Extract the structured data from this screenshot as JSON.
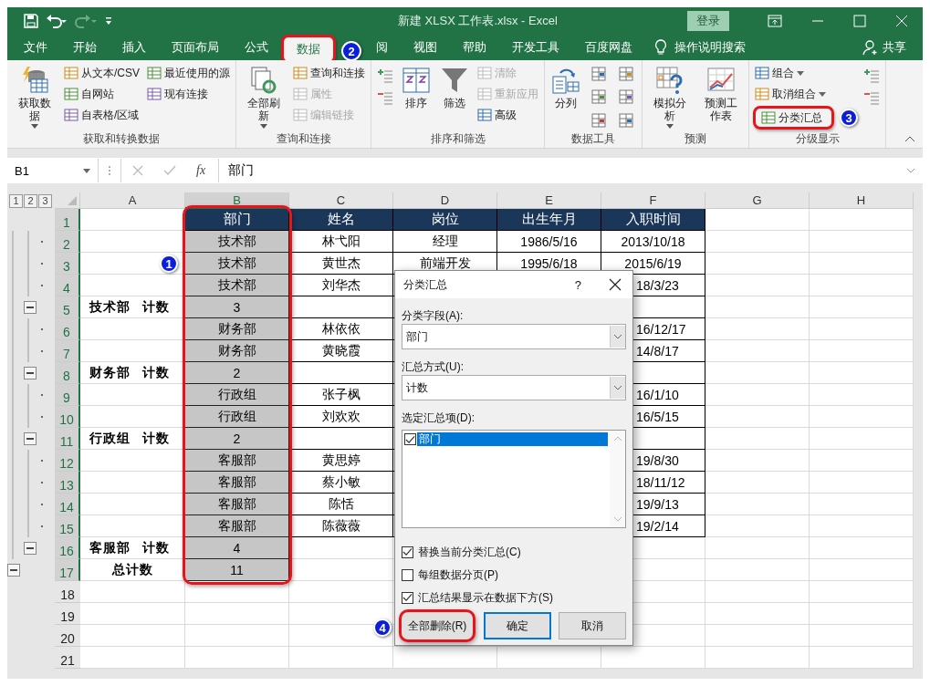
{
  "title_bar": {
    "title": "新建 XLSX 工作表.xlsx  -  Excel",
    "sign_in": "登录"
  },
  "tabs": [
    {
      "label": "文件",
      "selected": false,
      "highlighted": false
    },
    {
      "label": "开始",
      "selected": false,
      "highlighted": false
    },
    {
      "label": "插入",
      "selected": false,
      "highlighted": false
    },
    {
      "label": "页面布局",
      "selected": false,
      "highlighted": false
    },
    {
      "label": "公式",
      "selected": false,
      "highlighted": false
    },
    {
      "label": "数据",
      "selected": true,
      "highlighted": true,
      "marker": "2"
    },
    {
      "label": "阅",
      "selected": false,
      "highlighted": false
    },
    {
      "label": "视图",
      "selected": false,
      "highlighted": false
    },
    {
      "label": "帮助",
      "selected": false,
      "highlighted": false
    },
    {
      "label": "开发工具",
      "selected": false,
      "highlighted": false
    },
    {
      "label": "百度网盘",
      "selected": false,
      "highlighted": false
    }
  ],
  "tell_me": "操作说明搜索",
  "share": "共享",
  "ribbon": [
    {
      "label": "获取和转换数据",
      "items": [
        {
          "kind": "large",
          "label": "获取数据",
          "dropdown": true
        },
        {
          "kind": "column",
          "items": [
            {
              "label": "从文本/CSV",
              "disabled": false
            },
            {
              "label": "自网站",
              "disabled": false
            },
            {
              "label": "自表格/区域",
              "disabled": false
            }
          ]
        },
        {
          "kind": "column",
          "items": [
            {
              "label": "最近使用的源",
              "disabled": false
            },
            {
              "label": "现有连接",
              "disabled": false
            }
          ]
        }
      ]
    },
    {
      "label": "查询和连接",
      "items": [
        {
          "kind": "large",
          "label": "全部刷新",
          "dropdown": true
        },
        {
          "kind": "column",
          "items": [
            {
              "label": "查询和连接",
              "disabled": false
            },
            {
              "label": "属性",
              "disabled": true
            },
            {
              "label": "编辑链接",
              "disabled": true
            }
          ]
        }
      ]
    },
    {
      "label": "排序和筛选",
      "items": [
        {
          "kind": "icon_column"
        },
        {
          "kind": "large",
          "label": "排序",
          "dropdown": false
        },
        {
          "kind": "large",
          "label": "筛选",
          "dropdown": false
        },
        {
          "kind": "column",
          "items": [
            {
              "label": "清除",
              "disabled": true
            },
            {
              "label": "重新应用",
              "disabled": true
            },
            {
              "label": "高级",
              "disabled": false
            }
          ]
        }
      ]
    },
    {
      "label": "数据工具",
      "items": [
        {
          "kind": "large",
          "label": "分列",
          "dropdown": false
        },
        {
          "kind": "icon_grid"
        }
      ]
    },
    {
      "label": "预测",
      "items": [
        {
          "kind": "large",
          "label": "模拟分析",
          "dropdown": true
        },
        {
          "kind": "large",
          "label": "预测工作表",
          "dropdown": false
        }
      ]
    },
    {
      "label": "分级显示",
      "items": [
        {
          "kind": "column",
          "items": [
            {
              "label": "组合",
              "disabled": false,
              "dropdown": true
            },
            {
              "label": "取消组合",
              "disabled": false,
              "dropdown": true
            },
            {
              "label": "分类汇总",
              "disabled": false,
              "highlighted": true,
              "marker": "3"
            }
          ]
        },
        {
          "kind": "icon_column"
        }
      ]
    }
  ],
  "formula_bar": {
    "name_box": "B1",
    "function_label": "fx",
    "formula": "部门"
  },
  "sheet": {
    "outline_levels": [
      "1",
      "2",
      "3"
    ],
    "columns": [
      {
        "label": "A",
        "selected": false
      },
      {
        "label": "B",
        "selected": true,
        "highlighted": true,
        "marker": "1"
      },
      {
        "label": "C",
        "selected": false
      },
      {
        "label": "D",
        "selected": false
      },
      {
        "label": "E",
        "selected": false
      },
      {
        "label": "F",
        "selected": false
      },
      {
        "label": "G",
        "selected": false
      },
      {
        "label": "H",
        "selected": false
      }
    ],
    "rows": [
      {
        "num": "1",
        "kind": "header",
        "selected": true,
        "bordered": true,
        "b": "部门",
        "c": "姓名",
        "d": "岗位",
        "e": "出生年月",
        "f": "入职时间"
      },
      {
        "num": "2",
        "kind": "data",
        "selected": true,
        "bordered": true,
        "outline": {
          "kind": "dot"
        },
        "b": "技术部",
        "c": "林弋阳",
        "d": "经理",
        "e": "1986/5/16",
        "f": "2013/10/18"
      },
      {
        "num": "3",
        "kind": "data",
        "selected": true,
        "bordered": true,
        "outline": {
          "kind": "dot"
        },
        "b": "技术部",
        "c": "黄世杰",
        "d": "前端开发",
        "e": "1995/6/18",
        "f": "2015/6/19"
      },
      {
        "num": "4",
        "kind": "data",
        "selected": true,
        "bordered": true,
        "outline": {
          "kind": "dot"
        },
        "b": "技术部",
        "c": "刘华杰",
        "f": "18/3/23",
        "f_cut": true
      },
      {
        "num": "5",
        "kind": "subtotal",
        "selected": true,
        "bordered": true,
        "outline": {
          "kind": "minus"
        },
        "a": "技术部 计数",
        "b": "3"
      },
      {
        "num": "6",
        "kind": "data",
        "selected": true,
        "bordered": true,
        "outline": {
          "kind": "dot"
        },
        "b": "财务部",
        "c": "林依依",
        "f": "16/12/17",
        "f_cut": true
      },
      {
        "num": "7",
        "kind": "data",
        "selected": true,
        "bordered": true,
        "outline": {
          "kind": "dot"
        },
        "b": "财务部",
        "c": "黄晓霞",
        "f": "14/8/17",
        "f_cut": true
      },
      {
        "num": "8",
        "kind": "subtotal",
        "selected": true,
        "bordered": true,
        "outline": {
          "kind": "minus"
        },
        "a": "财务部 计数",
        "b": "2"
      },
      {
        "num": "9",
        "kind": "data",
        "selected": true,
        "bordered": true,
        "outline": {
          "kind": "dot"
        },
        "b": "行政组",
        "c": "张子枫",
        "f": "16/1/10",
        "f_cut": true
      },
      {
        "num": "10",
        "kind": "data",
        "selected": true,
        "bordered": true,
        "outline": {
          "kind": "dot"
        },
        "b": "行政组",
        "c": "刘欢欢",
        "f": "16/5/15",
        "f_cut": true
      },
      {
        "num": "11",
        "kind": "subtotal",
        "selected": true,
        "bordered": true,
        "outline": {
          "kind": "minus"
        },
        "a": "行政组 计数",
        "b": "2"
      },
      {
        "num": "12",
        "kind": "data",
        "selected": true,
        "bordered": true,
        "outline": {
          "kind": "dot"
        },
        "b": "客服部",
        "c": "黄思婷",
        "f": "19/8/30",
        "f_cut": true
      },
      {
        "num": "13",
        "kind": "data",
        "selected": true,
        "bordered": true,
        "outline": {
          "kind": "dot"
        },
        "b": "客服部",
        "c": "蔡小敏",
        "f": "18/11/12",
        "f_cut": true
      },
      {
        "num": "14",
        "kind": "data",
        "selected": true,
        "bordered": true,
        "outline": {
          "kind": "dot"
        },
        "b": "客服部",
        "c": "陈恬",
        "f": "19/9/13",
        "f_cut": true
      },
      {
        "num": "15",
        "kind": "data",
        "selected": true,
        "bordered": true,
        "outline": {
          "kind": "dot"
        },
        "b": "客服部",
        "c": "陈薇薇",
        "f": "19/2/14",
        "f_cut": true
      },
      {
        "num": "16",
        "kind": "subtotal",
        "selected": true,
        "bordered": false,
        "outline": {
          "kind": "minus"
        },
        "a": "客服部 计数",
        "b": "4"
      },
      {
        "num": "17",
        "kind": "total",
        "selected": true,
        "bordered": false,
        "outline": {
          "kind": "outer_minus"
        },
        "a": "总计数",
        "b": "11"
      },
      {
        "num": "18",
        "kind": "empty",
        "selected": false,
        "bordered": false
      },
      {
        "num": "19",
        "kind": "empty",
        "selected": false,
        "bordered": false
      },
      {
        "num": "20",
        "kind": "empty",
        "selected": false,
        "bordered": false
      },
      {
        "num": "21",
        "kind": "empty",
        "selected": false,
        "bordered": false
      }
    ]
  },
  "dialog": {
    "title": "分类汇总",
    "help": "?",
    "fields": [
      {
        "label": "分类字段(A):",
        "value": "部门"
      },
      {
        "label": "汇总方式(U):",
        "value": "计数"
      }
    ],
    "list_label": "选定汇总项(D):",
    "list_items": [
      {
        "label": "部门",
        "checked": true,
        "selected": true
      }
    ],
    "options": [
      {
        "label": "替换当前分类汇总(C)",
        "checked": true
      },
      {
        "label": "每组数据分页(P)",
        "checked": false
      },
      {
        "label": "汇总结果显示在数据下方(S)",
        "checked": true
      }
    ],
    "buttons": [
      {
        "label": "全部删除(R)",
        "default": false,
        "highlighted": true,
        "marker": "4"
      },
      {
        "label": "确定",
        "default": true,
        "highlighted": false
      },
      {
        "label": "取消",
        "default": false,
        "highlighted": false
      }
    ]
  }
}
